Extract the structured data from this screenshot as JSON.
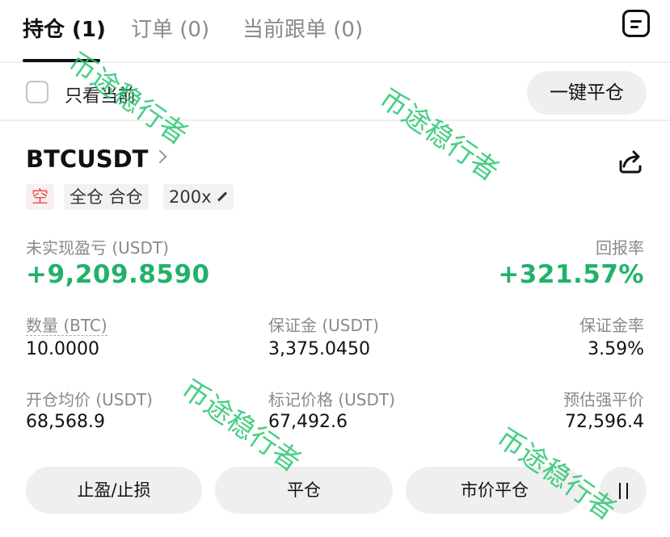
{
  "tabs": [
    {
      "label": "持仓 (1)"
    },
    {
      "label": "订单 (0)"
    },
    {
      "label": "当前跟单 (0)"
    }
  ],
  "filter": {
    "label": "只看当前",
    "checked": false
  },
  "close_all_label": "一键平仓",
  "position": {
    "symbol": "BTCUSDT",
    "side": "空",
    "margin_mode": "全仓 合仓",
    "leverage": "200x",
    "pnl_label": "未实现盈亏 (USDT)",
    "pnl_value": "+9,209.8590",
    "roe_label": "回报率",
    "roe_value": "+321.57%",
    "qty_label": "数量 (BTC)",
    "qty_value": "10.0000",
    "margin_label": "保证金 (USDT)",
    "margin_value": "3,375.0450",
    "margin_rate_label": "保证金率",
    "margin_rate_value": "3.59%",
    "entry_label": "开仓均价 (USDT)",
    "entry_value": "68,568.9",
    "mark_label": "标记价格 (USDT)",
    "mark_value": "67,492.6",
    "liq_label": "预估强平价",
    "liq_value": "72,596.4"
  },
  "actions": {
    "tp_sl": "止盈/止损",
    "close": "平仓",
    "market_close": "市价平仓"
  },
  "watermark": "币途稳行者",
  "colors": {
    "profit": "#21b26a",
    "short": "#e25555",
    "watermark": "#28c76f"
  }
}
